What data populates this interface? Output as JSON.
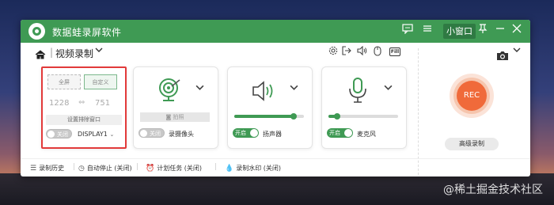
{
  "app": {
    "title": "数据蛙录屏软件",
    "mini_window_label": "小窗口",
    "icons": [
      "chat-icon",
      "menu-icon",
      "pin-icon",
      "minimize-icon",
      "close-icon"
    ]
  },
  "breadcrumb": {
    "label": "视频录制"
  },
  "toolbar": {
    "icons": [
      "settings-icon",
      "export-icon",
      "volume-icon",
      "mouse-icon",
      "fill-icon"
    ],
    "fill_label": "Fill"
  },
  "area_card": {
    "fullscreen_label": "全屏",
    "custom_label": "自定义",
    "width": "1228",
    "height": "751",
    "exclude_label": "设置排除窗口",
    "toggle_label": "关闭",
    "display_label": "DISPLAY1"
  },
  "camera_card": {
    "photo_label": "拍照",
    "toggle_label": "关闭",
    "name": "录摄像头"
  },
  "speaker_card": {
    "toggle_label": "开启",
    "name": "扬声器",
    "volume": 0.85
  },
  "mic_card": {
    "toggle_label": "开启",
    "name": "麦克风",
    "volume": 0.12
  },
  "rec": {
    "label": "REC",
    "advanced_label": "高级录制"
  },
  "footer": {
    "history": "录制历史",
    "auto_stop": "自动停止 (关闭)",
    "schedule": "计划任务 (关闭)",
    "watermark": "录制水印 (关闭)"
  },
  "wallpaper_watermark": "@稀土掘金技术社区",
  "colors": {
    "brand_green": "#3f9a54",
    "rec_orange": "#f06a3a",
    "highlight_red": "#e23a3a"
  }
}
